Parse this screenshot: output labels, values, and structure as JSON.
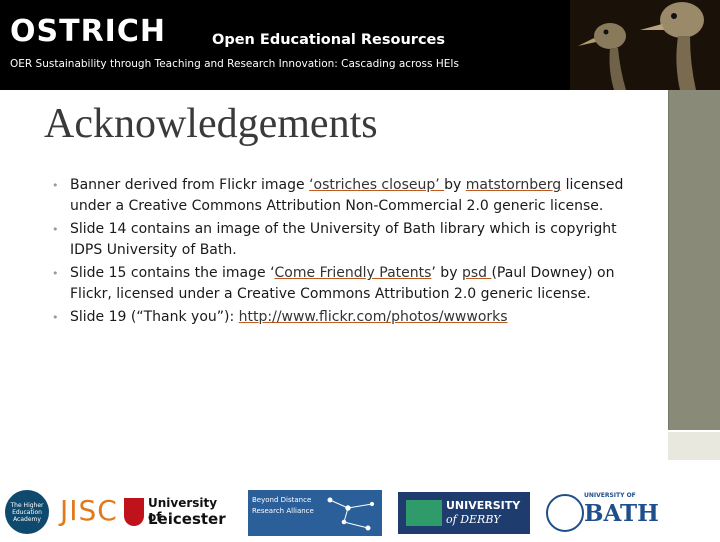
{
  "banner": {
    "title": "OSTRICH",
    "subtitle": "Open Educational Resources",
    "tagline": "OER Sustainability through Teaching and Research Innovation: Cascading across HEIs"
  },
  "main": {
    "title": "Acknowledgements",
    "bullets": [
      {
        "pre": "Banner derived from Flickr image ",
        "link1": "‘ostriches closeup’ ",
        "mid": "by ",
        "link2": "matstornberg",
        "post": " licensed under a Creative Commons Attribution Non-Commercial 2.0 generic license."
      },
      {
        "text": "Slide 14 contains an image of the University of Bath library which is copyright IDPS University of Bath."
      },
      {
        "pre": "Slide 15 contains the image ‘",
        "link1": "Come Friendly Patents",
        "mid": "’ by ",
        "link2": "psd ",
        "post": "(Paul Downey) on Flickr, licensed under a Creative Commons Attribution 2.0 generic license."
      },
      {
        "pre": "Slide 19 (“Thank you”): ",
        "link1": "http://www.flickr.com/photos/wwworks"
      }
    ]
  },
  "logos": {
    "hea": "The Higher Education Academy",
    "jisc": "JISC",
    "leicester_1": "University of",
    "leicester_2": "Leicester",
    "bdra_1": "Beyond Distance",
    "bdra_2": "Research Alliance",
    "derby_1": "UNIVERSITY",
    "derby_2": "of DERBY",
    "bath_1": "UNIVERSITY OF",
    "bath_2": "BATH"
  },
  "colors": {
    "banner_bg": "#000000",
    "link_underline": "#c05a20",
    "side_block": "#8a8a78"
  }
}
